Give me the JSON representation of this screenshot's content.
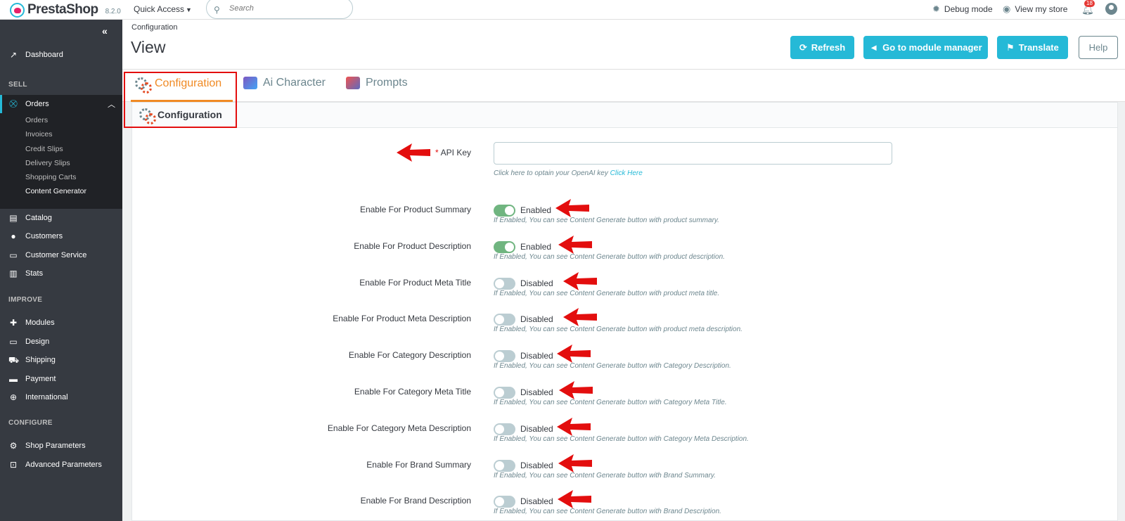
{
  "app": {
    "name": "PrestaShop",
    "version": "8.2.0"
  },
  "topbar": {
    "quick_access": "Quick Access",
    "search_placeholder": "Search",
    "debug_mode": "Debug mode",
    "view_store": "View my store",
    "notifications": "18"
  },
  "sidebar": {
    "dashboard": "Dashboard",
    "sell_header": "SELL",
    "orders": "Orders",
    "orders_sub": [
      "Orders",
      "Invoices",
      "Credit Slips",
      "Delivery Slips",
      "Shopping Carts",
      "Content Generator"
    ],
    "catalog": "Catalog",
    "customers": "Customers",
    "customer_service": "Customer Service",
    "stats": "Stats",
    "improve_header": "IMPROVE",
    "modules": "Modules",
    "design": "Design",
    "shipping": "Shipping",
    "payment": "Payment",
    "international": "International",
    "configure_header": "CONFIGURE",
    "shop_parameters": "Shop Parameters",
    "advanced_parameters": "Advanced Parameters"
  },
  "header": {
    "breadcrumb": "Configuration",
    "title": "View",
    "refresh": "Refresh",
    "module_manager": "Go to module manager",
    "translate": "Translate",
    "help": "Help"
  },
  "tabs": [
    "Configuration",
    "Ai Character",
    "Prompts"
  ],
  "panel": {
    "title": "Configuration",
    "api_key_label": "API Key",
    "api_key_value": "",
    "api_help": "Click here to optain your OpenAI key",
    "api_help_link": "Click Here",
    "fields": [
      {
        "label": "Enable For Product Summary",
        "state": "Enabled",
        "help": "If Enabled, You can see Content Generate button with product summary."
      },
      {
        "label": "Enable For Product Description",
        "state": "Enabled",
        "help": "If Enabled, You can see Content Generate button with product description."
      },
      {
        "label": "Enable For Product Meta Title",
        "state": "Disabled",
        "help": "If Enabled, You can see Content Generate button with product meta title."
      },
      {
        "label": "Enable For Product Meta Description",
        "state": "Disabled",
        "help": "If Enabled, You can see Content Generate button with product meta description."
      },
      {
        "label": "Enable For Category Description",
        "state": "Disabled",
        "help": "If Enabled, You can see Content Generate button with Category Description."
      },
      {
        "label": "Enable For Category Meta Title",
        "state": "Disabled",
        "help": "If Enabled, You can see Content Generate button with Category Meta Title."
      },
      {
        "label": "Enable For Category Meta Description",
        "state": "Disabled",
        "help": "If Enabled, You can see Content Generate button with Category Meta Description."
      },
      {
        "label": "Enable For Brand Summary",
        "state": "Disabled",
        "help": "If Enabled, You can see Content Generate button with Brand Summary."
      },
      {
        "label": "Enable For Brand Description",
        "state": "Disabled",
        "help": "If Enabled, You can see Content Generate button with Brand Description."
      }
    ]
  },
  "colors": {
    "accent": "#25b9d7",
    "active_tab": "#f08a24",
    "toggle_on": "#70b580",
    "annotation": "#e30e0e"
  }
}
